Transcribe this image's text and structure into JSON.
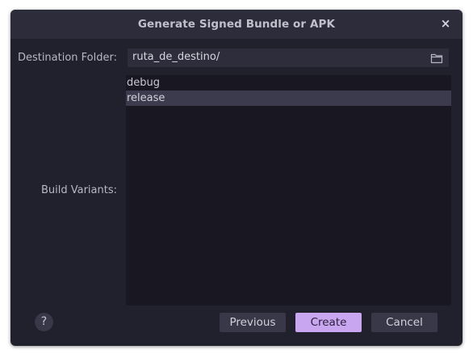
{
  "dialog": {
    "title": "Generate Signed Bundle or APK",
    "close_label": "×"
  },
  "destination": {
    "label": "Destination Folder:",
    "value": "ruta_de_destino/",
    "icon": "folder-icon"
  },
  "build_variants": {
    "label": "Build Variants:",
    "items": [
      {
        "label": "debug",
        "selected": false
      },
      {
        "label": "release",
        "selected": true
      }
    ]
  },
  "footer": {
    "help_label": "?",
    "previous_label": "Previous",
    "create_label": "Create",
    "cancel_label": "Cancel"
  },
  "colors": {
    "dialog_bg": "#21202d",
    "titlebar_bg": "#2d2c3b",
    "accent": "#c9a6f0",
    "selection": "#3b3b4d"
  }
}
